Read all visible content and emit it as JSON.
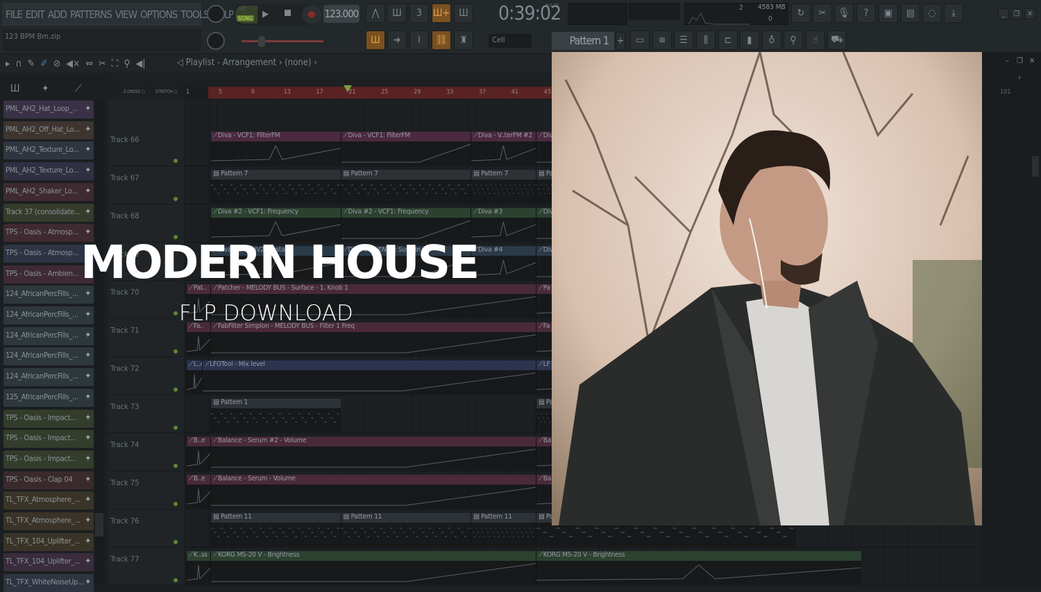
{
  "menu": [
    "FILE",
    "EDIT",
    "ADD",
    "PATTERNS",
    "VIEW",
    "OPTIONS",
    "TOOLS",
    "HELP"
  ],
  "hint_text": "123 BPM Bm.zip",
  "transport": {
    "pat_label": "PAT",
    "song_label": "SONG",
    "tempo": "123.000",
    "time": "0:39:02",
    "time_format": "M:S:CS"
  },
  "monitor": {
    "memory": "4583 MB",
    "cpu": "2",
    "polyphony": "0"
  },
  "pattern_selector": "Pattern 1",
  "snap": "Cell",
  "playlist": {
    "title": "Playlist - Arrangement",
    "breadcrumb": "(none)",
    "right_ruler": "101"
  },
  "ruler": [
    "1",
    "5",
    "9",
    "13",
    "17",
    "21",
    "25",
    "29",
    "33",
    "37",
    "41",
    "45"
  ],
  "headline": "MODERN HOUSE",
  "subheadline": "FLP DOWNLOAD",
  "channels": [
    {
      "name": "PML_AH2_Hat_Loop_...",
      "color": "#3a3146"
    },
    {
      "name": "PML_AH2_Off_Hat_Lo...",
      "color": "#3e3530"
    },
    {
      "name": "PML_AH2_Texture_Lo...",
      "color": "#2f3640"
    },
    {
      "name": "PML_AH2_Texture_Lo...",
      "color": "#312f42"
    },
    {
      "name": "PML_AH2_Shaker_Lo...",
      "color": "#3e2a30"
    },
    {
      "name": "Track 37 (consolidate...",
      "color": "#363c2c"
    },
    {
      "name": "TPS - Oasis - Atmosp...",
      "color": "#3e2a30"
    },
    {
      "name": "TPS - Oasis - Atmosp...",
      "color": "#2e3444"
    },
    {
      "name": "TPS - Oasis - Ambien...",
      "color": "#3e2a34"
    },
    {
      "name": "124_AfricanPercFills_...",
      "color": "#2e383c"
    },
    {
      "name": "124_AfricanPercFills_...",
      "color": "#2e383c"
    },
    {
      "name": "124_AfricanPercFills_...",
      "color": "#2e383c"
    },
    {
      "name": "124_AfricanPercFills_...",
      "color": "#2e383c"
    },
    {
      "name": "124_AfricanPercFills_...",
      "color": "#2e383c"
    },
    {
      "name": "125_AfricanPercFills_...",
      "color": "#2e383c"
    },
    {
      "name": "TPS - Oasis - Impact...",
      "color": "#343d2c"
    },
    {
      "name": "TPS - Oasis - Impact...",
      "color": "#343d2c"
    },
    {
      "name": "TPS - Oasis - Impact...",
      "color": "#343d2c"
    },
    {
      "name": "TPS - Oasis - Clap 04",
      "color": "#3a2a2c"
    },
    {
      "name": "TL_TFX_Atmosphere_...",
      "color": "#3a3428"
    },
    {
      "name": "TL_TFX_Atmosphere_...",
      "color": "#3a3428"
    },
    {
      "name": "TL_TFX_104_Uplifter_...",
      "color": "#3a3428"
    },
    {
      "name": "TL_TFX_104_Uplifter_...",
      "color": "#3a2c3c"
    },
    {
      "name": "TL_TFX_WhiteNoiseUp...",
      "color": "#2e3440"
    }
  ],
  "tracks": [
    {
      "name": "Track 66",
      "color": "#4a2a40",
      "type": "auto",
      "clips": [
        {
          "label": "Diva - VCF1: FilterFM",
          "start": 4,
          "len": 16
        },
        {
          "label": "Diva - VCF1: FilterFM",
          "start": 20,
          "len": 16
        },
        {
          "label": "Diva - V..terFM #2",
          "start": 36,
          "len": 8
        },
        {
          "label": "Div",
          "start": 44,
          "len": 8
        }
      ]
    },
    {
      "name": "Track 67",
      "color": "#2c3236",
      "type": "pattern",
      "clips": [
        {
          "label": "Pattern 7",
          "start": 4,
          "len": 16
        },
        {
          "label": "Pattern 7",
          "start": 20,
          "len": 16
        },
        {
          "label": "Pattern 7",
          "start": 36,
          "len": 8
        },
        {
          "label": "Pa",
          "start": 44,
          "len": 8
        }
      ]
    },
    {
      "name": "Track 68",
      "color": "#2c4230",
      "type": "auto",
      "clips": [
        {
          "label": "Diva #2 - VCF1: Frequency",
          "start": 4,
          "len": 16
        },
        {
          "label": "Diva #2 - VCF1: Frequency",
          "start": 20,
          "len": 16
        },
        {
          "label": "Diva #3",
          "start": 36,
          "len": 8
        },
        {
          "label": "Div",
          "start": 44,
          "len": 8
        }
      ]
    },
    {
      "name": "Track 69",
      "color": "#2a3a48",
      "type": "auto",
      "clips": [
        {
          "label": "Diva #2 - ENV2: Sustain",
          "start": 4,
          "len": 16
        },
        {
          "label": "Diva #2 - ENV2: Sustain",
          "start": 20,
          "len": 16
        },
        {
          "label": "Diva #4",
          "start": 36,
          "len": 8
        },
        {
          "label": "Div",
          "start": 44,
          "len": 8
        }
      ]
    },
    {
      "name": "Track 70",
      "color": "#4a2a38",
      "type": "auto",
      "clips": [
        {
          "label": "Pat..",
          "start": 1,
          "len": 3
        },
        {
          "label": "Patcher - MELODY BUS - Surface - 1. Knob 1",
          "start": 4,
          "len": 40
        },
        {
          "label": "Pa",
          "start": 44,
          "len": 8
        }
      ]
    },
    {
      "name": "Track 71",
      "color": "#4a2a38",
      "type": "auto",
      "clips": [
        {
          "label": "Fa..",
          "start": 1,
          "len": 3
        },
        {
          "label": "FabFilter Simplon - MELODY BUS - Filter 1 Freq",
          "start": 4,
          "len": 40
        },
        {
          "label": "Fa",
          "start": 44,
          "len": 8
        }
      ]
    },
    {
      "name": "Track 72",
      "color": "#2c3450",
      "type": "auto",
      "clips": [
        {
          "label": "L..el",
          "start": 1,
          "len": 2
        },
        {
          "label": "LFOTool - Mix level",
          "start": 3,
          "len": 41
        },
        {
          "label": "LF",
          "start": 44,
          "len": 8
        }
      ]
    },
    {
      "name": "Track 73",
      "color": "#2c3236",
      "type": "pattern",
      "clips": [
        {
          "label": "Pattern 1",
          "start": 4,
          "len": 16
        },
        {
          "label": "Pa",
          "start": 44,
          "len": 8
        }
      ]
    },
    {
      "name": "Track 74",
      "color": "#4a2a38",
      "type": "auto",
      "clips": [
        {
          "label": "B..e",
          "start": 1,
          "len": 3
        },
        {
          "label": "Balance - Serum #2 - Volume",
          "start": 4,
          "len": 40
        },
        {
          "label": "Ba",
          "start": 44,
          "len": 8
        }
      ]
    },
    {
      "name": "Track 75",
      "color": "#4a2a38",
      "type": "auto",
      "clips": [
        {
          "label": "B..e",
          "start": 1,
          "len": 3
        },
        {
          "label": "Balance - Serum - Volume",
          "start": 4,
          "len": 40
        },
        {
          "label": "Ba",
          "start": 44,
          "len": 8
        }
      ]
    },
    {
      "name": "Track 76",
      "color": "#2c3236",
      "type": "pattern",
      "clips": [
        {
          "label": "Pattern 11",
          "start": 4,
          "len": 16
        },
        {
          "label": "Pattern 11",
          "start": 20,
          "len": 16
        },
        {
          "label": "Pattern 11",
          "start": 36,
          "len": 8
        },
        {
          "label": "Pa",
          "start": 44,
          "len": 32
        }
      ]
    },
    {
      "name": "Track 77",
      "color": "#2c4230",
      "type": "auto",
      "clips": [
        {
          "label": "K..ss",
          "start": 1,
          "len": 3
        },
        {
          "label": "KORG MS-20 V - Brightness",
          "start": 4,
          "len": 40
        },
        {
          "label": "KORG MS-20 V - Brightness",
          "start": 44,
          "len": 40
        }
      ]
    }
  ]
}
